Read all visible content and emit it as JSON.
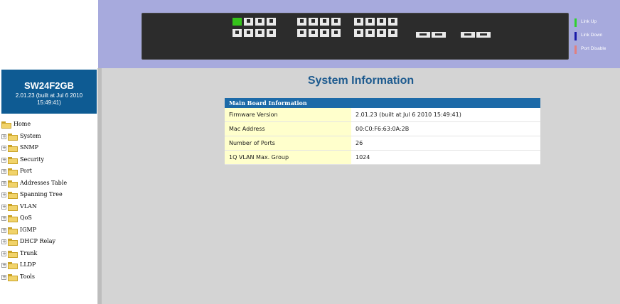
{
  "legend": [
    {
      "label": "Link Up",
      "color": "#2fd12f"
    },
    {
      "label": "Link Down",
      "color": "#1a1aa8"
    },
    {
      "label": "Port Disable",
      "color": "#e08080"
    }
  ],
  "sidebar": {
    "model": "SW24F2GB",
    "version": "2.01.23 (built at Jul 6 2010 15:49:41)",
    "home": "Home",
    "items": [
      {
        "label": "System"
      },
      {
        "label": "SNMP"
      },
      {
        "label": "Security"
      },
      {
        "label": "Port"
      },
      {
        "label": "Addresses Table"
      },
      {
        "label": "Spanning Tree"
      },
      {
        "label": "VLAN"
      },
      {
        "label": "QoS"
      },
      {
        "label": "IGMP"
      },
      {
        "label": "DHCP Relay"
      },
      {
        "label": "Trunk"
      },
      {
        "label": "LLDP"
      },
      {
        "label": "Tools"
      }
    ]
  },
  "main": {
    "title": "System Information",
    "table_header": "Main Board Information",
    "rows": [
      {
        "label": "Firmware Version",
        "value": "2.01.23 (built at Jul 6 2010 15:49:41)"
      },
      {
        "label": "Mac Address",
        "value": "00:C0:F6:63:0A:2B"
      },
      {
        "label": "Number of Ports",
        "value": "26"
      },
      {
        "label": "1Q VLAN Max. Group",
        "value": "1024"
      }
    ]
  },
  "ports": {
    "total": 26,
    "link_up": [
      1
    ]
  }
}
